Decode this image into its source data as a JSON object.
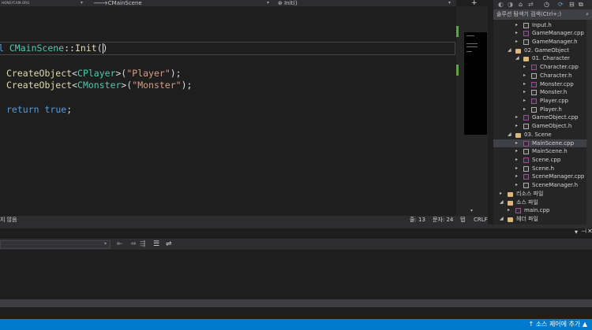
{
  "watermark": "HONEYCAM.ORG",
  "nav": {
    "scope": "(전역 범위)",
    "class": "CMainScene",
    "method": "Init()"
  },
  "code": {
    "signature_kw": "l",
    "signature_class": "CMainScene",
    "signature_sep": "::",
    "signature_fn": "Init",
    "signature_parens": "()",
    "line1_fn": "CreateObject",
    "line1_open": "<",
    "line1_type": "CPlayer",
    "line1_close": ">(",
    "line1_str": "\"Player\"",
    "line1_end": ");",
    "line2_fn": "CreateObject",
    "line2_open": "<",
    "line2_type": "CMonster",
    "line2_close": ">(",
    "line2_str": "\"Monster\"",
    "line2_end": ");",
    "ret_kw": "return",
    "ret_val": "true",
    "ret_end": ";"
  },
  "editor_status": {
    "issues": "지 않음",
    "line": "줄: 13",
    "char": "문자: 24",
    "tab": "탭",
    "eol": "CRLF"
  },
  "solution_explorer": {
    "search_placeholder": "솔루션 탐색기 검색(Ctrl+;)",
    "items": [
      {
        "label": "Input.h",
        "type": "h"
      },
      {
        "label": "GameManager.cpp",
        "type": "cpp"
      },
      {
        "label": "GameManager.h",
        "type": "h"
      },
      {
        "label": "02. GameObject",
        "type": "folder"
      },
      {
        "label": "01. Character",
        "type": "folder"
      },
      {
        "label": "Character.cpp",
        "type": "cpp"
      },
      {
        "label": "Character.h",
        "type": "h"
      },
      {
        "label": "Monster.cpp",
        "type": "cpp"
      },
      {
        "label": "Monster.h",
        "type": "h"
      },
      {
        "label": "Player.cpp",
        "type": "cpp"
      },
      {
        "label": "Player.h",
        "type": "h"
      },
      {
        "label": "GameObject.cpp",
        "type": "cpp"
      },
      {
        "label": "GameObject.h",
        "type": "h"
      },
      {
        "label": "03. Scene",
        "type": "folder"
      },
      {
        "label": "MainScene.cpp",
        "type": "cpp",
        "selected": true
      },
      {
        "label": "MainScene.h",
        "type": "h"
      },
      {
        "label": "Scene.cpp",
        "type": "cpp"
      },
      {
        "label": "Scene.h",
        "type": "h"
      },
      {
        "label": "SceneManager.cpp",
        "type": "cpp"
      },
      {
        "label": "SceneManager.h",
        "type": "h"
      },
      {
        "label": "리소스 파일",
        "type": "folder"
      },
      {
        "label": "소스 파일",
        "type": "folder"
      },
      {
        "label": "main.cpp",
        "type": "cpp"
      },
      {
        "label": "헤더 파일",
        "type": "folder"
      }
    ]
  },
  "statusbar": {
    "scm": "소스 제어에 추가",
    "scm_arrow": "▲",
    "scm_icon": "↑"
  },
  "colors": {
    "accent": "#007acc",
    "editor_bg": "#1e1e1e",
    "keyword": "#569cd6",
    "type": "#4ec9b0",
    "function": "#dcdcaa",
    "string": "#d69d85"
  }
}
